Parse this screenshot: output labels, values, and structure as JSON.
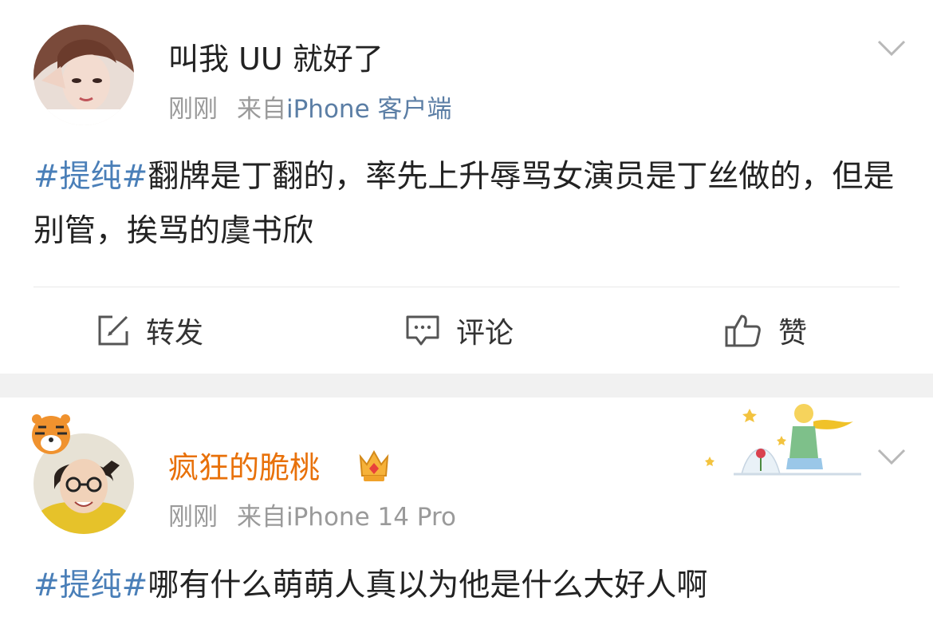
{
  "posts": [
    {
      "username": "叫我 UU 就好了",
      "time": "刚刚",
      "from_prefix": "来自",
      "source": "iPhone 客户端",
      "hashtag": "#提纯#",
      "text": "翻牌是丁翻的，率先上升辱骂女演员是丁丝做的，但是别管，挨骂的虞书欣",
      "actions": {
        "repost": "转发",
        "comment": "评论",
        "like": "赞"
      }
    },
    {
      "username": "疯狂的脆桃",
      "time": "刚刚",
      "from_prefix": "来自",
      "source": "iPhone 14 Pro",
      "hashtag": "#提纯#",
      "text": "哪有什么萌萌人真以为他是什么大好人啊",
      "username_color": "#e8710a"
    }
  ],
  "icons": [
    "edit-icon",
    "comment-icon",
    "thumbs-up-icon",
    "chevron-down-icon",
    "vip-crown-icon"
  ]
}
